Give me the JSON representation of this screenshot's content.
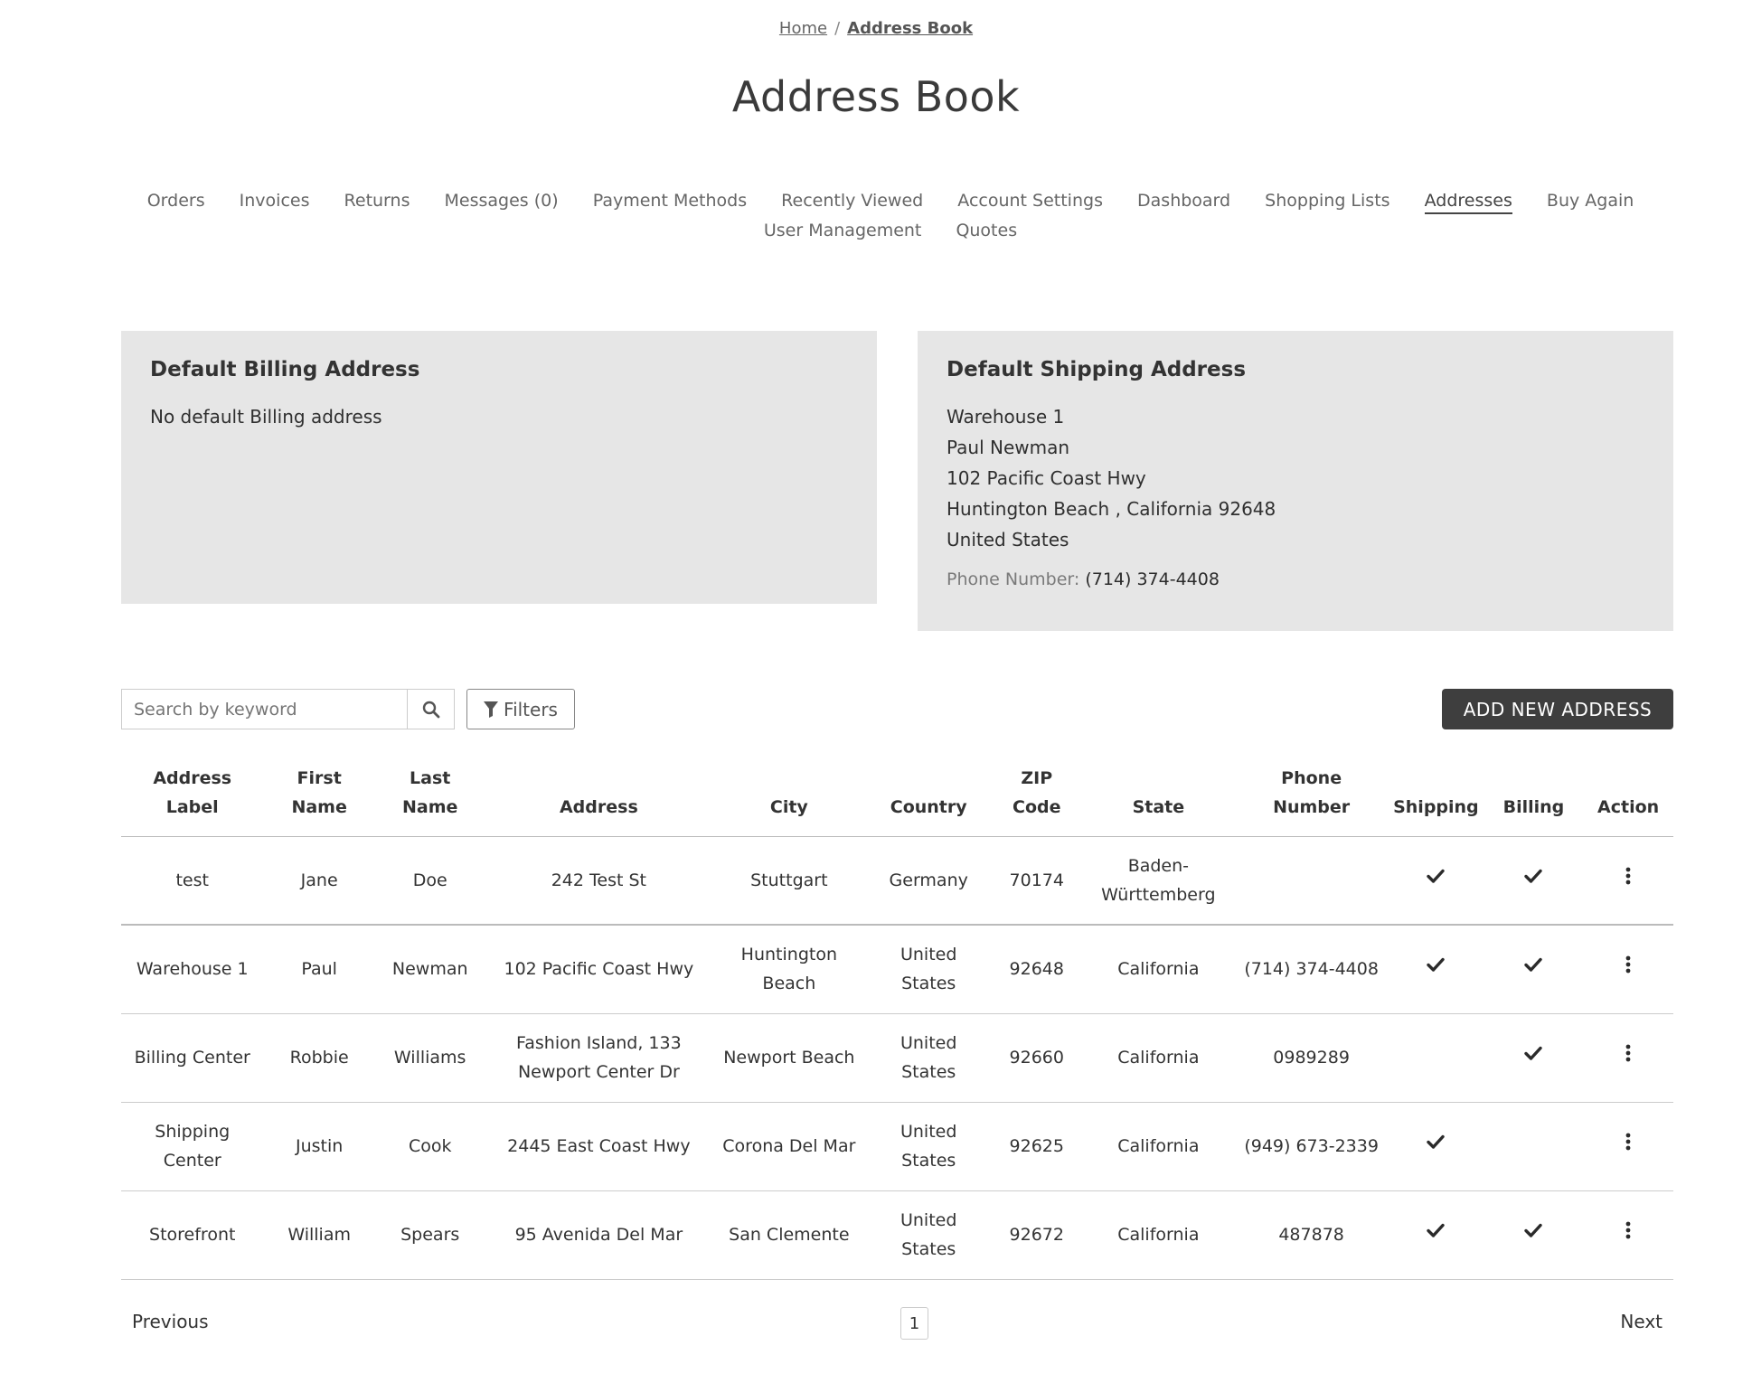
{
  "breadcrumb": {
    "home": "Home",
    "separator": "/",
    "current": "Address Book"
  },
  "page_title": "Address Book",
  "nav": {
    "items": [
      "Orders",
      "Invoices",
      "Returns",
      "Messages (0)",
      "Payment Methods",
      "Recently Viewed",
      "Account Settings",
      "Dashboard",
      "Shopping Lists",
      "Addresses",
      "Buy Again",
      "User Management",
      "Quotes"
    ],
    "active": "Addresses"
  },
  "billing_card": {
    "title": "Default Billing Address",
    "empty_text": "No default Billing address"
  },
  "shipping_card": {
    "title": "Default Shipping Address",
    "lines": [
      "Warehouse 1",
      "Paul Newman",
      "102 Pacific Coast Hwy",
      "Huntington Beach , California 92648",
      "United States"
    ],
    "phone_label": "Phone Number:",
    "phone_value": "(714) 374-4408"
  },
  "toolbar": {
    "search_placeholder": "Search by keyword",
    "filters_label": "Filters",
    "add_label": "ADD NEW ADDRESS"
  },
  "table": {
    "headers": [
      "Address Label",
      "First Name",
      "Last Name",
      "Address",
      "City",
      "Country",
      "ZIP Code",
      "State",
      "Phone Number",
      "Shipping",
      "Billing",
      "Action"
    ],
    "rows": [
      {
        "label": "test",
        "first": "Jane",
        "last": "Doe",
        "address": "242 Test St",
        "city": "Stuttgart",
        "country": "Germany",
        "zip": "70174",
        "state": "Baden-Württemberg",
        "phone": "",
        "shipping": true,
        "billing": true
      },
      {
        "label": "Warehouse 1",
        "first": "Paul",
        "last": "Newman",
        "address": "102 Pacific Coast Hwy",
        "city": "Huntington Beach",
        "country": "United States",
        "zip": "92648",
        "state": "California",
        "phone": "(714) 374-4408",
        "shipping": true,
        "billing": true
      },
      {
        "label": "Billing Center",
        "first": "Robbie",
        "last": "Williams",
        "address": "Fashion Island, 133 Newport Center Dr",
        "city": "Newport Beach",
        "country": "United States",
        "zip": "92660",
        "state": "California",
        "phone": "0989289",
        "shipping": false,
        "billing": true
      },
      {
        "label": "Shipping Center",
        "first": "Justin",
        "last": "Cook",
        "address": "2445 East Coast Hwy",
        "city": "Corona Del Mar",
        "country": "United States",
        "zip": "92625",
        "state": "California",
        "phone": "(949) 673-2339",
        "shipping": true,
        "billing": false
      },
      {
        "label": "Storefront",
        "first": "William",
        "last": "Spears",
        "address": "95 Avenida Del Mar",
        "city": "San Clemente",
        "country": "United States",
        "zip": "92672",
        "state": "California",
        "phone": "487878",
        "shipping": true,
        "billing": true
      }
    ]
  },
  "pagination": {
    "previous": "Previous",
    "current_page": "1",
    "next": "Next"
  },
  "icons": {
    "search": "search-icon",
    "filter": "filter-icon",
    "check": "check-icon",
    "action": "more-vertical-icon"
  },
  "colors": {
    "card_bg": "#e6e6e6",
    "primary_button": "#3e3e3e"
  }
}
